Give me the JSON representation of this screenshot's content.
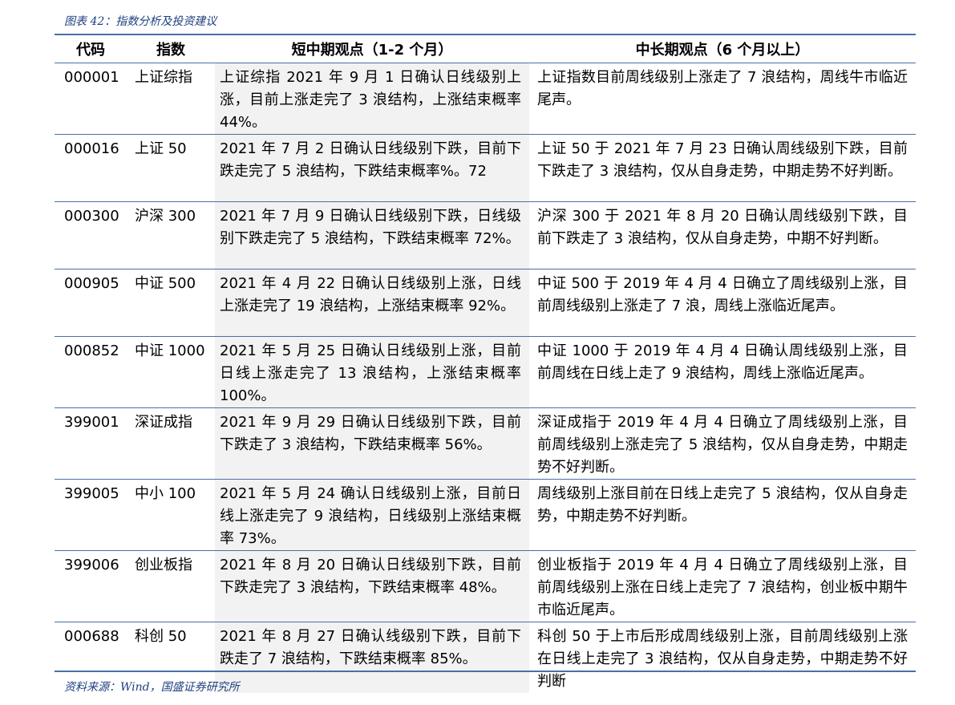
{
  "caption": "图表 42：指数分析及投资建议",
  "headers": [
    "代码",
    "指数",
    "短中期观点（1-2 个月）",
    "中长期观点（6 个月以上）"
  ],
  "rows": [
    {
      "code": "000001",
      "index": "上证综指",
      "short": "上证综指 2021 年 9 月 1 日确认日线级别上涨，目前上涨走完了 3 浪结构，上涨结束概率 44%。",
      "long": "上证指数目前周线级别上涨走了 7 浪结构，周线牛市临近尾声。"
    },
    {
      "code": "000016",
      "index": "上证 50",
      "short": "2021 年 7 月 2 日确认日线级别下跌，目前下跌走完了 5 浪结构，下跌结束概率%。72",
      "long": "上证 50 于 2021 年 7 月 23 日确认周线级别下跌，目前下跌走了 3 浪结构，仅从自身走势，中期走势不好判断。"
    },
    {
      "code": "000300",
      "index": "沪深 300",
      "short": "2021 年 7 月 9 日确认日线级别下跌，日线级别下跌走完了 5 浪结构，下跌结束概率 72%。",
      "long": "沪深 300 于 2021 年 8 月 20 日确认周线级别下跌，目前下跌走了 3 浪结构，仅从自身走势，中期不好判断。"
    },
    {
      "code": "000905",
      "index": "中证 500",
      "short": "2021 年 4 月 22 日确认日线级别上涨，日线上涨走完了 19 浪结构，上涨结束概率 92%。",
      "long": "中证 500 于 2019 年 4 月 4 日确立了周线级别上涨，目前周线级别上涨走了 7 浪，周线上涨临近尾声。"
    },
    {
      "code": "000852",
      "index": "中证 1000",
      "short": "2021 年 5 月 25 日确认日线级别上涨，目前日线上涨走完了 13 浪结构，上涨结束概率 100%。",
      "long": "中证 1000 于 2019 年 4 月 4 日确认周线级别上涨，目前周线在日线上走了 9 浪结构，周线上涨临近尾声。"
    },
    {
      "code": "399001",
      "index": "深证成指",
      "short": "2021 年 9 月 29 日确认日线级别下跌，目前下跌走了 3 浪结构，下跌结束概率 56%。",
      "long": "深证成指于 2019 年 4 月 4 日确立了周线级别上涨，目前周线级别上涨走完了 5 浪结构，仅从自身走势，中期走势不好判断。"
    },
    {
      "code": "399005",
      "index": "中小 100",
      "short": "2021 年 5 月 24 确认日线级别上涨，目前日线上涨走完了 9 浪结构，日线级别上涨结束概率 73%。",
      "long": "周线级别上涨目前在日线上走完了 5 浪结构，仅从自身走势，中期走势不好判断。"
    },
    {
      "code": "399006",
      "index": "创业板指",
      "short": "2021 年 8 月 20 日确认日线级别下跌，目前下跌走完了 3 浪结构，下跌结束概率 48%。",
      "long": "创业板指于 2019 年 4 月 4 日确立了周线级别上涨，目前周线级别上涨在日线上走完了 7 浪结构，创业板中期牛市临近尾声。"
    },
    {
      "code": "000688",
      "index": "科创 50",
      "short": "2021 年 8 月 27 日确认线级别下跌，目前下跌走了 7 浪结构，下跌结束概率 85%。",
      "long": "科创 50 于上市后形成周线级别上涨，目前周线级别上涨在日线上走完了 3 浪结构，仅从自身走势，中期走势不好判断"
    }
  ],
  "source": "资料来源：Wind，国盛证券研究所"
}
